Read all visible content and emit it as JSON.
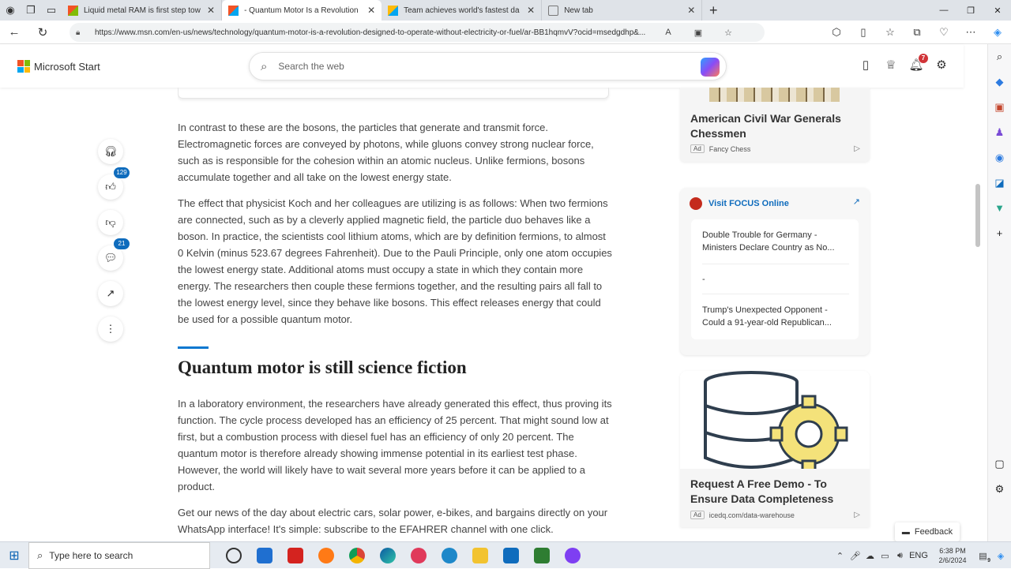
{
  "browser": {
    "tabs": [
      {
        "title": "Liquid metal RAM is first step tow",
        "active": false
      },
      {
        "title": "- Quantum Motor Is a Revolution",
        "active": true
      },
      {
        "title": "Team achieves world's fastest da",
        "active": false
      },
      {
        "title": "New tab",
        "active": false
      }
    ],
    "url": "https://www.msn.com/en-us/news/technology/quantum-motor-is-a-revolution-designed-to-operate-without-electricity-or-fuel/ar-BB1hqmvV?ocid=msedgdhp&..."
  },
  "header": {
    "logo": "Microsoft Start",
    "search_placeholder": "Search the web",
    "notification_count": "7"
  },
  "floating": {
    "likes": "129",
    "comments": "21"
  },
  "article": {
    "p1": "In contrast to these are the bosons, the particles that generate and transmit force. Electromagnetic forces are conveyed by photons, while gluons convey strong nuclear force, such as is responsible for the cohesion within an atomic nucleus. Unlike fermions, bosons accumulate together and all take on the lowest energy state.",
    "p2": "The effect that physicist Koch and her colleagues are utilizing is as follows: When two fermions are connected, such as by a cleverly applied magnetic field, the particle duo behaves like a boson. In practice, the scientists cool lithium atoms, which are by definition fermions, to almost 0 Kelvin (minus 523.67 degrees Fahrenheit). Due to the Pauli Principle, only one atom occupies the lowest energy state. Additional atoms must occupy a state in which they contain more energy. The researchers then couple these fermions together, and the resulting pairs all fall to the lowest energy level, since they behave like bosons. This effect releases energy that could be used for a possible quantum motor.",
    "heading": "Quantum motor is still science fiction",
    "p3": "In a laboratory environment, the researchers have already generated this effect, thus proving its function. The cycle process developed has an efficiency of 25 percent. That might sound low at first, but a combustion process with diesel fuel has an efficiency of only 20 percent. The quantum motor is therefore already showing immense potential in its earliest test phase. However, the world will likely have to wait several more years before it can be applied to a product.",
    "p4": "Get our news of the day about electric cars, solar power, e-bikes, and bargains directly on your WhatsApp interface! It's simple: subscribe to the EFAHRER channel with one click."
  },
  "sidebar": {
    "ad1": {
      "title": "American Civil War Generals Chessmen",
      "label": "Ad",
      "source": "Fancy Chess"
    },
    "focus": {
      "title": "Visit FOCUS Online",
      "items": [
        "Double Trouble for Germany - Ministers Declare Country as No...",
        "-",
        "Trump's Unexpected Opponent - Could a 91-year-old Republican..."
      ]
    },
    "ad2": {
      "title": "Request A Free Demo - To Ensure Data Completeness",
      "label": "Ad",
      "source": "icedq.com/data-warehouse"
    }
  },
  "feedback": "Feedback",
  "taskbar": {
    "search_placeholder": "Type here to search",
    "lang": "ENG",
    "time": "6:38 PM",
    "date": "2/6/2024",
    "notif_count": "9"
  }
}
